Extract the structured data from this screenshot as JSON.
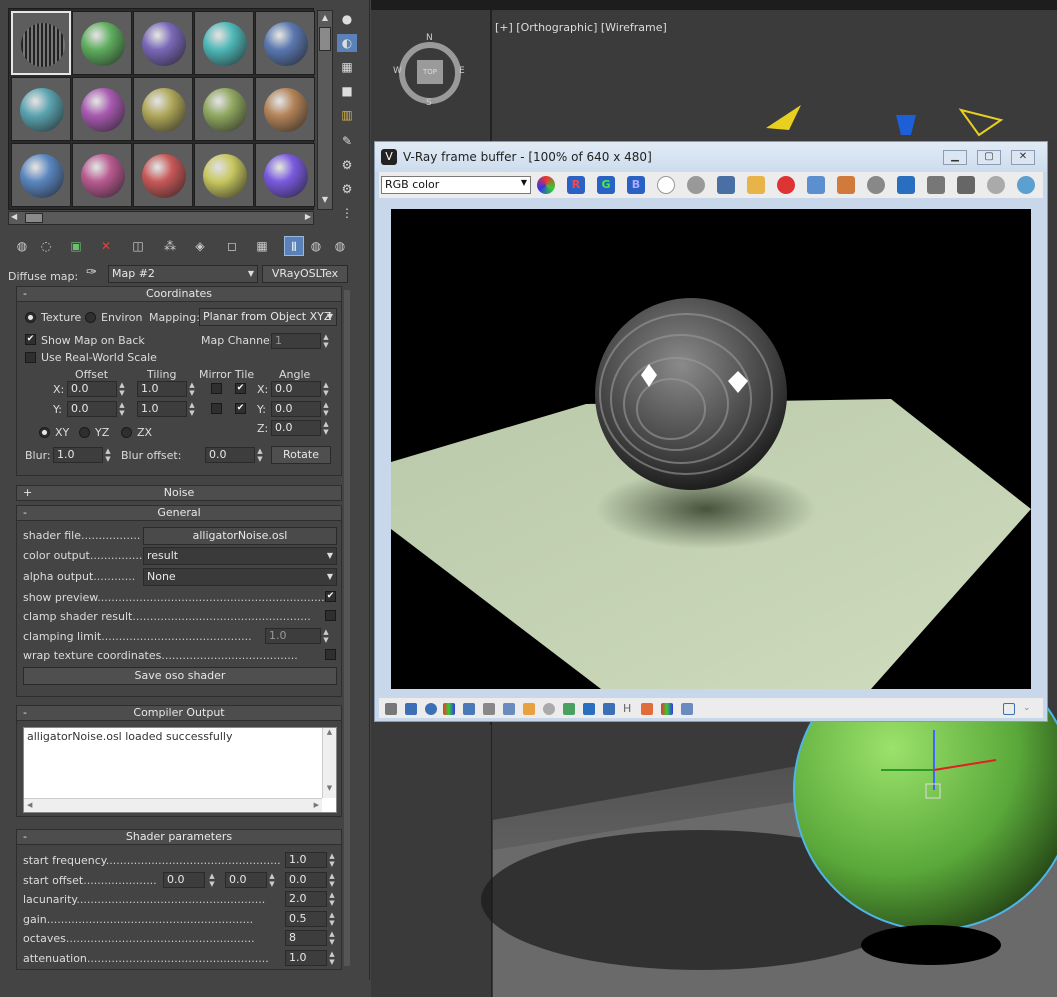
{
  "material_editor": {
    "diffuse_label": "Diffuse map:",
    "map_name": "Map #2",
    "map_type": "VRayOSLTex",
    "coordinates": {
      "header": "Coordinates",
      "texture": "Texture",
      "environ": "Environ",
      "mapping_label": "Mapping:",
      "mapping_value": "Planar from Object XYZ",
      "show_map_on_back": "Show Map on Back",
      "map_channel_label": "Map Channel:",
      "map_channel_value": "1",
      "use_real_world": "Use Real-World Scale",
      "offset": "Offset",
      "tiling": "Tiling",
      "mirror_tile": "Mirror Tile",
      "angle": "Angle",
      "x": "X:",
      "y": "Y:",
      "z": "Z:",
      "offset_x": "0.0",
      "offset_y": "0.0",
      "tiling_x": "1.0",
      "tiling_y": "1.0",
      "angle_x": "0.0",
      "angle_y": "0.0",
      "angle_z": "0.0",
      "xy": "XY",
      "yz": "YZ",
      "zx": "ZX",
      "blur_label": "Blur:",
      "blur_value": "1.0",
      "blur_offset_label": "Blur offset:",
      "blur_offset_value": "0.0",
      "rotate": "Rotate"
    },
    "noise_header": "Noise",
    "general": {
      "header": "General",
      "shader_file_label": "shader file",
      "shader_file_value": "alligatorNoise.osl",
      "color_output_label": "color output",
      "color_output_value": "result",
      "alpha_output_label": "alpha output",
      "alpha_output_value": "None",
      "show_preview": "show preview",
      "clamp_shader_result": "clamp shader result",
      "clamping_limit": "clamping limit",
      "clamping_limit_value": "1.0",
      "wrap_texture_coordinates": "wrap texture coordinates",
      "save_oso": "Save oso shader"
    },
    "compiler": {
      "header": "Compiler Output",
      "text": "alligatorNoise.osl loaded successfully"
    },
    "shader_params": {
      "header": "Shader parameters",
      "start_frequency": "start frequency",
      "start_frequency_value": "1.0",
      "start_offset": "start offset",
      "start_offset_1": "0.0",
      "start_offset_2": "0.0",
      "start_offset_3": "0.0",
      "lacunarity": "lacunarity",
      "lacunarity_value": "2.0",
      "gain": "gain",
      "gain_value": "0.5",
      "octaves": "octaves",
      "octaves_value": "8",
      "attenuation": "attenuation",
      "attenuation_value": "1.0"
    },
    "slot_colors": [
      "#7a7a7a",
      "#5fae5f",
      "#7a68b8",
      "#4fb8b8",
      "#5a78b0",
      "#5aa4b0",
      "#a85ab0",
      "#b0a85a",
      "#90a860",
      "#b48458",
      "#5a86c0",
      "#b85a90",
      "#c85858",
      "#c8c860",
      "#7a5ae0"
    ]
  },
  "viewport": {
    "label": "[+] [Orthographic] [Wireframe]",
    "compass_top": "TOP",
    "n": "N",
    "s": "S",
    "e": "E",
    "w": "W"
  },
  "framebuffer": {
    "title": "V-Ray frame buffer - [100% of 640 x 480]",
    "channel": "RGB color",
    "r": "R",
    "g": "G",
    "b": "B"
  }
}
